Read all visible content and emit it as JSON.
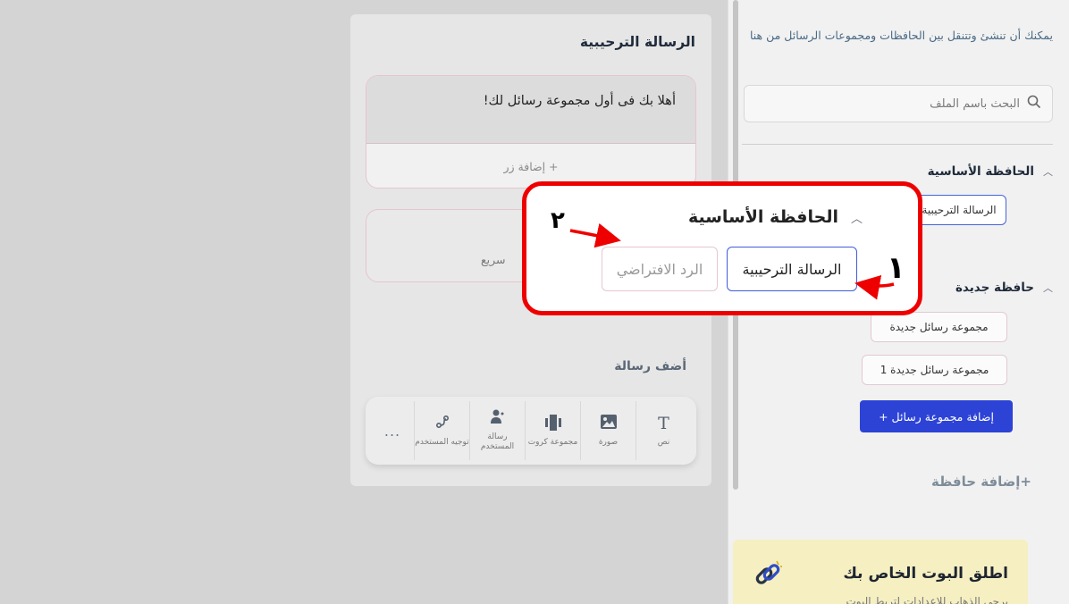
{
  "sidebar": {
    "description": "يمكنك أن تنشئ وتتنقل بين الحافظات ومجموعات الرسائل من هنا",
    "search_placeholder": "البحث باسم الملف",
    "folders": [
      {
        "title": "الحافظة الأساسية",
        "chips": [
          "الرسالة الترحيبية"
        ]
      },
      {
        "title": "حافظة جديدة",
        "chips": [
          "مجموعة رسائل جديدة",
          "مجموعة رسائل جديدة 1"
        ]
      }
    ],
    "add_group_button": "إضافة مجموعة رسائل +",
    "add_folder": "+إضافة حافظة",
    "launch": {
      "title": "اطلق البوت الخاص بك",
      "subtitle": "يرجى الذهاب للإعدادات لتربط البوت"
    }
  },
  "panel": {
    "title": "الرسالة الترحيبية",
    "message_text": "أهلا بك فى أول مجموعة رسائل لك!",
    "add_button": "+ إضافة زر",
    "quick_reply": "سريع",
    "add_message_label": "أضف رسالة",
    "tools": [
      {
        "icon": "text-icon",
        "glyph": "T",
        "label": "نص"
      },
      {
        "icon": "image-icon",
        "glyph": "▨",
        "label": "صورة"
      },
      {
        "icon": "cards-icon",
        "glyph": "▮▮▮",
        "label": "مجموعة كروت"
      },
      {
        "icon": "user-message-icon",
        "glyph": "👤",
        "label": "رسالة المستخدم"
      },
      {
        "icon": "redirect-icon",
        "glyph": "⤷",
        "label": "توجيه المستخدم"
      }
    ],
    "more": "..."
  },
  "callout": {
    "title": "الحافظة الأساسية",
    "chip_welcome": "الرسالة الترحيبية",
    "chip_default": "الرد الافتراضي",
    "number_1": "١",
    "number_2": "٢"
  },
  "colors": {
    "accent": "#2d43d6",
    "callout_border": "#ee0000",
    "selected_border": "#3f5ed8"
  }
}
